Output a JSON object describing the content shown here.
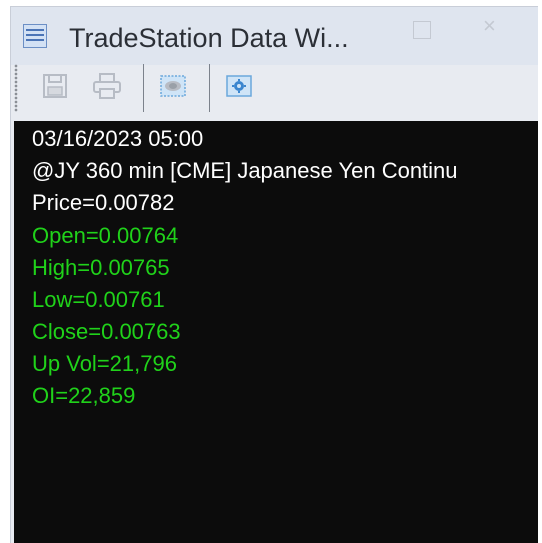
{
  "window": {
    "title": "TradeStation Data Wi..."
  },
  "titlebar_buttons": {
    "close_glyph": "×"
  },
  "toolbar": {
    "buttons": [
      {
        "icon": "save-icon"
      },
      {
        "icon": "print-icon"
      },
      {
        "icon": "view-icon"
      },
      {
        "icon": "settings-icon"
      }
    ]
  },
  "data_lines": {
    "datetime": "03/16/2023 05:00",
    "symbol": "@JY 360 min [CME] Japanese Yen Continu",
    "price": "Price=0.00782",
    "open": "Open=0.00764",
    "high": "High=0.00765",
    "low": "Low=0.00761",
    "close": "Close=0.00763",
    "up_vol": "Up Vol=21,796",
    "oi": "OI=22,859"
  },
  "colors": {
    "background": "#0c0c0c",
    "header_text": "#ffffff",
    "value_text": "#20d21a"
  }
}
